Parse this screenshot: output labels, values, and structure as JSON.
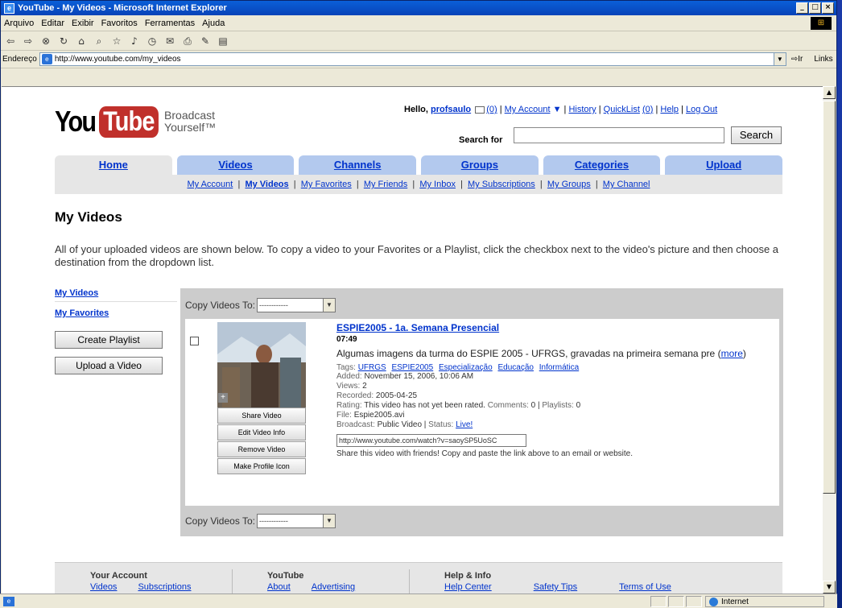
{
  "window": {
    "title": "YouTube - My Videos - Microsoft Internet Explorer",
    "menu": [
      "Arquivo",
      "Editar",
      "Exibir",
      "Favoritos",
      "Ferramentas",
      "Ajuda"
    ],
    "address_label": "Endereço",
    "address_value": "http://www.youtube.com/my_videos",
    "go_label": "Ir",
    "links_label": "Links",
    "status_zone": "Internet"
  },
  "header": {
    "logo_you": "You",
    "logo_tube": "Tube",
    "tagline_1": "Broadcast",
    "tagline_2": "Yourself™",
    "hello": "Hello,",
    "username": "profsaulo",
    "inbox_count": "(0)",
    "links": [
      "My Account",
      "History",
      "QuickList",
      "Help",
      "Log Out"
    ],
    "quicklist_count": "(0)",
    "search_label": "Search for",
    "search_button": "Search"
  },
  "tabs": [
    "Home",
    "Videos",
    "Channels",
    "Groups",
    "Categories",
    "Upload"
  ],
  "subnav": [
    "My Account",
    "My Videos",
    "My Favorites",
    "My Friends",
    "My Inbox",
    "My Subscriptions",
    "My Groups",
    "My Channel"
  ],
  "page": {
    "title": "My Videos",
    "intro": "All of your uploaded videos are shown below. To copy a video to your Favorites or a Playlist, click the checkbox next to the video's picture and then choose a destination from the dropdown list."
  },
  "sidebar": {
    "links": [
      "My Videos",
      "My Favorites"
    ],
    "buttons": [
      "Create Playlist",
      "Upload a Video"
    ]
  },
  "copy": {
    "label": "Copy Videos To:",
    "selected": "------------"
  },
  "video": {
    "title": "ESPIE2005 - 1a. Semana Presencial",
    "duration": "07:49",
    "description": "Algumas imagens da turma do ESPIE 2005 - UFRGS, gravadas na primeira semana pre",
    "more": "more",
    "tags_label": "Tags:",
    "tags": [
      "UFRGS",
      "ESPIE2005",
      "Especialização",
      "Educação",
      "Informática"
    ],
    "added_label": "Added:",
    "added": "November 15, 2006, 10:06 AM",
    "views_label": "Views:",
    "views": "2",
    "recorded_label": "Recorded:",
    "recorded": "2005-04-25",
    "rating_label": "Rating:",
    "rating": "This video has not yet been rated.",
    "comments_label": "Comments:",
    "comments": "0",
    "playlists_label": "Playlists:",
    "playlists": "0",
    "file_label": "File:",
    "file": "Espie2005.avi",
    "broadcast_label": "Broadcast:",
    "broadcast": "Public Video",
    "status_label": "Status:",
    "status": "Live!",
    "url": "http://www.youtube.com/watch?v=saoySP5UoSC",
    "share_note": "Share this video with friends! Copy and paste the link above to an email or website.",
    "actions": [
      "Share Video",
      "Edit Video Info",
      "Remove Video",
      "Make Profile Icon"
    ]
  },
  "footer": {
    "col1_title": "Your Account",
    "col1_links": [
      "Videos",
      "Subscriptions"
    ],
    "col2_title": "YouTube",
    "col2_links": [
      "About",
      "Advertising"
    ],
    "col3_title": "Help & Info",
    "col3_links": [
      "Help Center",
      "Safety Tips",
      "Terms of Use"
    ]
  },
  "colors": {
    "tab_blue": "#b3c9ee",
    "link_blue": "#0033cc",
    "logo_red": "#c0302b",
    "titlebar_blue": "#0a5fd8"
  }
}
